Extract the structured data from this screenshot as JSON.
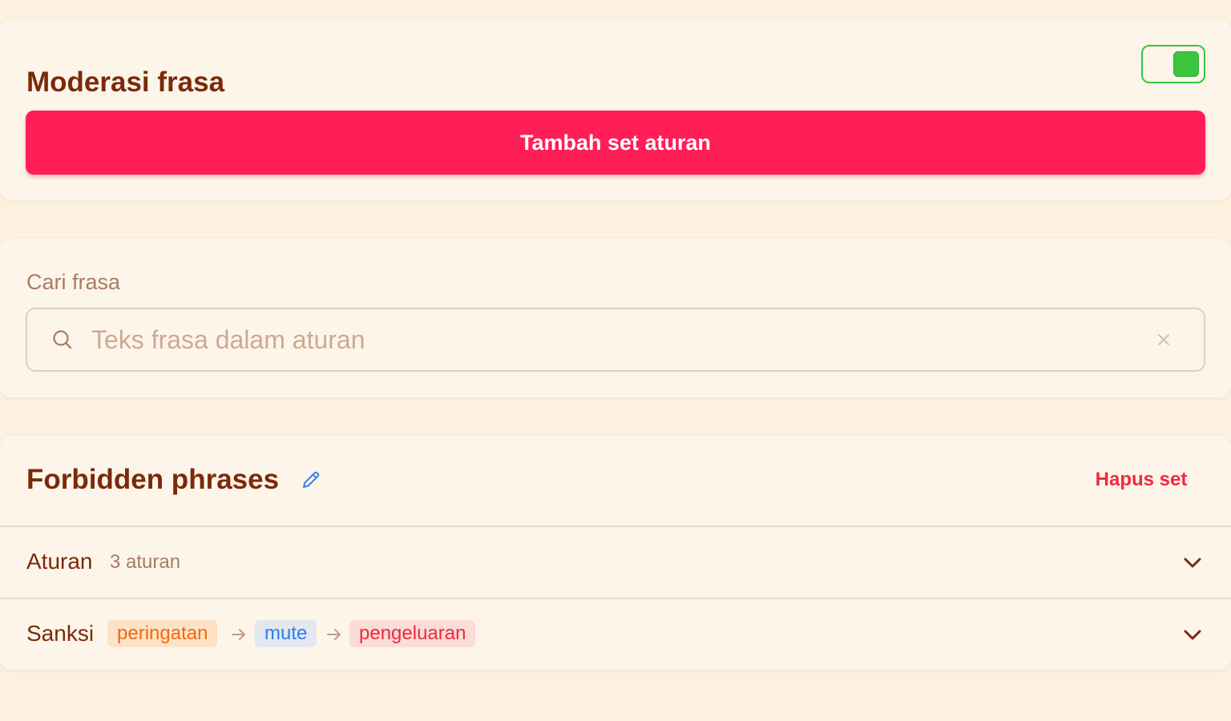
{
  "moderation": {
    "title": "Moderasi frasa",
    "enabled": true,
    "add_button_label": "Tambah set aturan"
  },
  "search": {
    "label": "Cari frasa",
    "placeholder": "Teks frasa dalam aturan",
    "value": ""
  },
  "rule_set": {
    "title": "Forbidden phrases",
    "delete_label": "Hapus set",
    "rules_row": {
      "label": "Aturan",
      "count_text": "3 aturan"
    },
    "sanctions_row": {
      "label": "Sanksi",
      "chips": [
        "peringatan",
        "mute",
        "pengeluaran"
      ]
    }
  },
  "colors": {
    "page_background": "#fdf0df",
    "card_background": "#fef5ea",
    "primary_button": "#ff1e56",
    "heading_text": "#7a2a0a",
    "toggle_on": "#3cc43f",
    "danger_text": "#f2283d",
    "chip_warning": "#f06a10",
    "chip_mute": "#2f7bea",
    "chip_kick": "#ea2c3e"
  },
  "icons": {
    "search": "search-icon",
    "clear": "close-icon",
    "edit": "pencil-icon",
    "expand": "chevron-down-icon",
    "flow": "arrow-right-icon"
  }
}
